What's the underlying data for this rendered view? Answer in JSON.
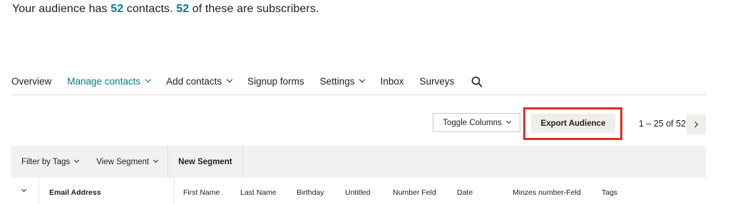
{
  "summary": {
    "prefix": "Your audience has ",
    "total": "52",
    "middle": " contacts. ",
    "subscribers": "52",
    "suffix": " of these are subscribers."
  },
  "nav": {
    "items": [
      {
        "label": "Overview"
      },
      {
        "label": "Manage contacts"
      },
      {
        "label": "Add contacts"
      },
      {
        "label": "Signup forms"
      },
      {
        "label": "Settings"
      },
      {
        "label": "Inbox"
      },
      {
        "label": "Surveys"
      }
    ],
    "search_icon": "search-icon"
  },
  "toolbar": {
    "toggle_columns": "Toggle Columns",
    "export": "Export Audience",
    "pager": "1 – 25 of 52"
  },
  "filters": {
    "tags": "Filter by Tags",
    "segment": "View Segment",
    "new_segment": "New Segment"
  },
  "table": {
    "columns": [
      "Email Address",
      "First Name",
      "Last Name",
      "Birthday",
      "Untitled",
      "Number Feld",
      "Date",
      "Minzes number-Feld",
      "Tags"
    ]
  },
  "colors": {
    "accent": "#007c89",
    "highlight": "#e22a2a",
    "button_bg": "#efeeea"
  }
}
